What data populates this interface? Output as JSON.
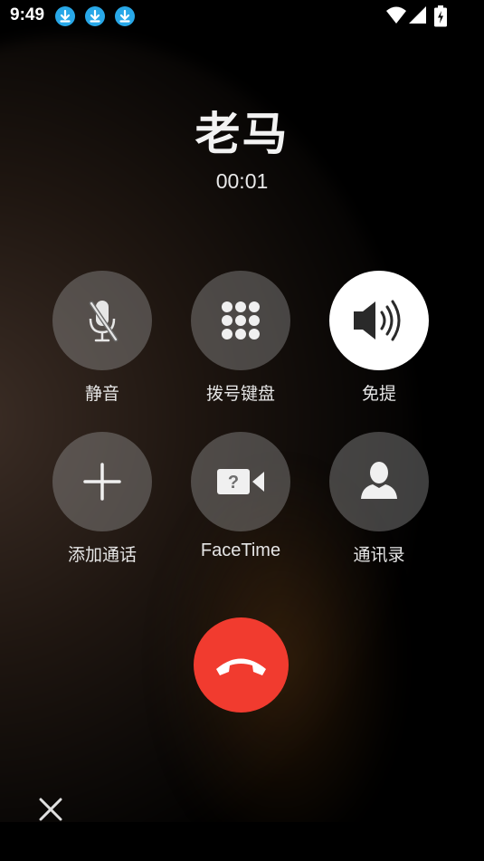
{
  "status_bar": {
    "time": "9:49",
    "icons": [
      "download-icon",
      "download-icon",
      "download-icon",
      "wifi-icon",
      "cellular-signal-icon",
      "battery-charging-icon"
    ]
  },
  "call": {
    "caller_name": "老马",
    "duration": "00:01"
  },
  "controls": [
    {
      "label": "静音",
      "icon": "microphone-muted-icon",
      "active": false
    },
    {
      "label": "拨号键盘",
      "icon": "keypad-icon",
      "active": false
    },
    {
      "label": "免提",
      "icon": "speaker-icon",
      "active": true
    },
    {
      "label": "添加通话",
      "icon": "plus-icon",
      "active": false
    },
    {
      "label": "FaceTime",
      "icon": "facetime-icon",
      "active": false
    },
    {
      "label": "通讯录",
      "icon": "contacts-icon",
      "active": false
    }
  ],
  "end_call": {
    "icon": "hang-up-icon",
    "color": "#f13b2f"
  },
  "close": {
    "icon": "close-icon"
  },
  "colors": {
    "download_badge": "#28a8e8",
    "button_bg": "rgba(150,150,150,0.42)",
    "active_button_bg": "#ffffff"
  }
}
